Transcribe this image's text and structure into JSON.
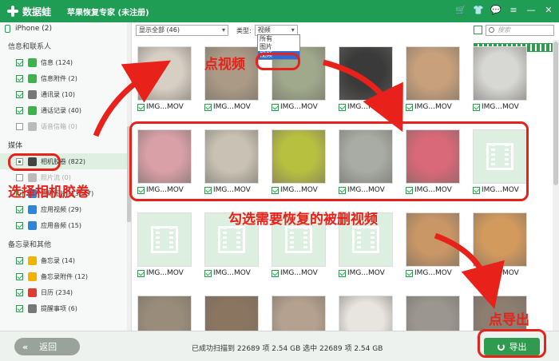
{
  "app": {
    "logo_text": "数据蛙",
    "title": "苹果恢复专家 (未注册)",
    "title_icons": [
      "cart-icon",
      "shirt-icon",
      "chat-icon",
      "menu-icon",
      "minimize-icon",
      "close-icon"
    ],
    "brand_color": "#1f9d55"
  },
  "sidebar": {
    "device": "iPhone (2)",
    "sections": [
      {
        "title": "信息和联系人",
        "items": [
          {
            "label": "信息 (124)",
            "checked": true,
            "icon_color": "#3cb44b"
          },
          {
            "label": "信息附件 (2)",
            "checked": true,
            "icon_color": "#3cb44b"
          },
          {
            "label": "通讯录 (10)",
            "checked": true,
            "icon_color": "#777777"
          },
          {
            "label": "通话记录 (40)",
            "checked": true,
            "icon_color": "#3cb44b"
          },
          {
            "label": "语音信箱 (0)",
            "checked": false,
            "icon_color": "#bbbbbb"
          }
        ]
      },
      {
        "title": "媒体",
        "items": [
          {
            "label": "相机胶卷 (822)",
            "checked": "partial",
            "icon_color": "#444444"
          },
          {
            "label": "照片流 (0)",
            "checked": false,
            "icon_color": "#bbbbbb"
          },
          {
            "label": "应用图片 (13047)",
            "checked": true,
            "icon_color": "#2f86d6"
          },
          {
            "label": "应用视频 (29)",
            "checked": true,
            "icon_color": "#2f86d6"
          },
          {
            "label": "应用音频 (15)",
            "checked": true,
            "icon_color": "#2f86d6"
          }
        ]
      },
      {
        "title": "备忘录和其他",
        "items": [
          {
            "label": "备忘录 (14)",
            "checked": true,
            "icon_color": "#f0b400"
          },
          {
            "label": "备忘录附件 (12)",
            "checked": true,
            "icon_color": "#f0b400"
          },
          {
            "label": "日历 (234)",
            "checked": true,
            "icon_color": "#e03c31"
          },
          {
            "label": "提醒事项 (6)",
            "checked": true,
            "icon_color": "#777777"
          }
        ]
      }
    ]
  },
  "toolbar": {
    "filter_value": "显示全部 (46)",
    "type_label": "类型:",
    "type_value": "视频",
    "type_options": [
      "所有",
      "图片",
      "视频"
    ],
    "search_placeholder": "搜索"
  },
  "grid": {
    "caption": "IMG...MOV",
    "rows": [
      [
        "#d8cfc4",
        "#ab9a86",
        "#a0a98c",
        "#3a3a3a",
        "#c8a07c",
        "#d7d7d3"
      ],
      [
        "#d9a0a8",
        "#c9c2b4",
        "#b8c040",
        "#a8aca4",
        "#d96878",
        "video"
      ],
      [
        "video",
        "video",
        "video",
        "video",
        "#c99665",
        "#d39a5d"
      ],
      [
        "#9a8c7a",
        "#8a7560",
        "#b5a190",
        "#e8e4df",
        "#9c9690",
        "#8c7e70"
      ]
    ]
  },
  "status": {
    "text": "已成功扫描到 22689 项 2.54 GB  选中 22689 项 2.54 GB"
  },
  "buttons": {
    "back": "返回",
    "export": "导出"
  },
  "annotations": {
    "click_video": "点视频",
    "select_camera_roll": "选择相机胶卷",
    "check_deleted": "勾选需要恢复的被删视频",
    "click_export": "点导出",
    "color": "#e8211a"
  }
}
